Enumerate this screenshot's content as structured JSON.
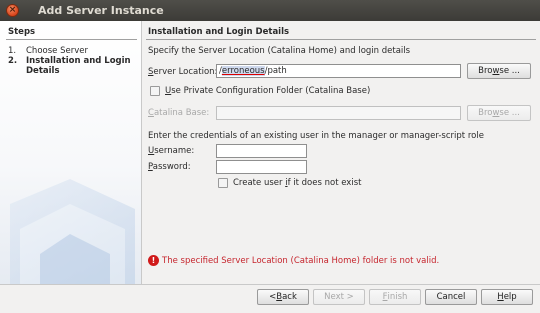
{
  "window": {
    "title": "Add Server Instance",
    "close_glyph": "×"
  },
  "steps": {
    "heading": "Steps",
    "items": [
      {
        "number": "1.",
        "label": "Choose Server",
        "active": false
      },
      {
        "number": "2.",
        "label": "Installation and Login Details",
        "active": true
      }
    ]
  },
  "main": {
    "heading": "Installation and Login Details",
    "description": "Specify the Server Location (Catalina Home) and login details",
    "server_location": {
      "label_mnemonic": "S",
      "label_rest": "erver Location:",
      "value_prefix": "/",
      "value_highlight": "erroneous",
      "value_suffix": "/path",
      "browse_mnemonic": "w",
      "browse_pre": "Bro",
      "browse_post": "se ..."
    },
    "private_config": {
      "mnemonic": "U",
      "rest": "se Private Configuration Folder (Catalina Base)",
      "checked": false
    },
    "catalina_base": {
      "label_mnemonic": "C",
      "label_rest": "atalina Base:",
      "value": "",
      "browse_pre": "Bro",
      "browse_mnemonic": "w",
      "browse_post": "se ..."
    },
    "credentials_text": "Enter the credentials of an existing user in the manager or manager-script role",
    "username": {
      "label_mnemonic": "U",
      "label_rest": "sername:",
      "value": ""
    },
    "password": {
      "label_mnemonic": "P",
      "label_rest": "assword:",
      "value": ""
    },
    "create_user": {
      "pre": "Create user ",
      "mnemonic": "i",
      "post": "f it does not exist",
      "checked": false
    },
    "error": {
      "icon": "!",
      "text": "The specified Server Location (Catalina Home) folder is not valid."
    }
  },
  "buttons": {
    "back": {
      "arrow": "< ",
      "mnemonic": "B",
      "rest": "ack"
    },
    "next": {
      "label": "Next >"
    },
    "finish": {
      "mnemonic": "F",
      "rest": "inish"
    },
    "cancel": {
      "label": "Cancel"
    },
    "help": {
      "mnemonic": "H",
      "rest": "elp"
    }
  },
  "colors": {
    "error": "#c6262e",
    "titlebar": "#3c3b37",
    "close_button": "#e35b2b",
    "watermark": "#b9cde6"
  }
}
